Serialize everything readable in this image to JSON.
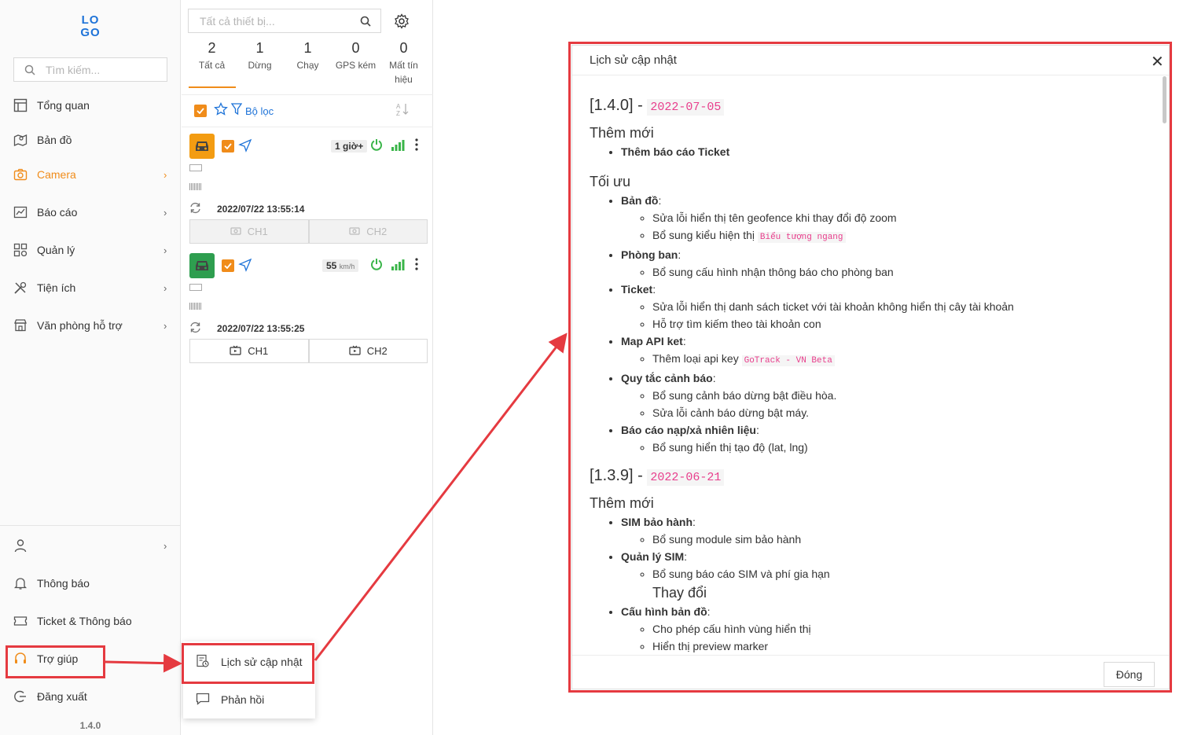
{
  "sidebar": {
    "logo_text": "LOGO",
    "search_placeholder": "Tìm kiếm...",
    "items": [
      {
        "label": "Tổng quan",
        "icon": "dashboard-icon"
      },
      {
        "label": "Bản đồ",
        "icon": "map-icon"
      },
      {
        "label": "Camera",
        "icon": "camera-icon",
        "active": true
      },
      {
        "label": "Báo cáo",
        "icon": "report-icon"
      },
      {
        "label": "Quản lý",
        "icon": "grid-icon"
      },
      {
        "label": "Tiện ích",
        "icon": "tools-icon"
      },
      {
        "label": "Văn phòng hỗ trợ",
        "icon": "store-icon"
      }
    ],
    "bottom_items": [
      {
        "label": "",
        "icon": "user-icon"
      },
      {
        "label": "Thông báo",
        "icon": "bell-icon"
      },
      {
        "label": "Ticket & Thông báo",
        "icon": "ticket-icon"
      },
      {
        "label": "Trợ giúp",
        "icon": "headset-icon"
      },
      {
        "label": "Đăng xuất",
        "icon": "logout-icon"
      }
    ],
    "version": "1.4.0"
  },
  "device_panel": {
    "search_placeholder": "Tất cả thiết bị...",
    "stats": [
      {
        "count": "2",
        "label": "Tất cả"
      },
      {
        "count": "1",
        "label": "Dừng"
      },
      {
        "count": "1",
        "label": "Chạy"
      },
      {
        "count": "0",
        "label": "GPS kém"
      },
      {
        "count": "0",
        "label": "Mất tín hiệu"
      }
    ],
    "filter_label": "Bộ lọc",
    "devices": [
      {
        "badge": "1 giờ+",
        "unit": "",
        "time": "2022/07/22 13:55:14",
        "ch1": "CH1",
        "ch2": "CH2",
        "status_color": "#f39c12"
      },
      {
        "badge": "55",
        "unit": "km/h",
        "time": "2022/07/22 13:55:25",
        "ch1": "CH1",
        "ch2": "CH2",
        "status_color": "#2e9e4f"
      }
    ]
  },
  "popup_menu": {
    "items": [
      {
        "label": "Lịch sử cập nhật",
        "icon": "history-icon"
      },
      {
        "label": "Phản hồi",
        "icon": "feedback-icon"
      }
    ]
  },
  "dialog": {
    "title": "Lịch sử cập nhật",
    "close_label": "Đóng",
    "releases": [
      {
        "version": "[1.4.0]",
        "sep": " - ",
        "date": "2022-07-05",
        "sections": {
          "added_title": "Thêm mới",
          "added_item": "Thêm báo cáo Ticket",
          "optimized_title": "Tối ưu",
          "map": {
            "title": "Bản đồ",
            "items": [
              "Sửa lỗi hiển thị tên geofence khi thay đổi độ zoom",
              "Bổ sung kiểu hiện thị"
            ],
            "code": "Biểu tượng ngang"
          },
          "dept": {
            "title": "Phòng ban",
            "items": [
              "Bổ sung cấu hình nhận thông báo cho phòng ban"
            ]
          },
          "ticket": {
            "title": "Ticket",
            "items": [
              "Sửa lỗi hiển thị danh sách ticket với tài khoản không hiển thị cây tài khoản",
              "Hỗ trợ tìm kiếm theo tài khoản con"
            ]
          },
          "mapapi": {
            "title": "Map API ket",
            "items": [
              "Thêm loại api key"
            ],
            "code": "GoTrack - VN Beta"
          },
          "alert": {
            "title": "Quy tắc cảnh báo",
            "items": [
              "Bổ sung cảnh báo dừng bật điều hòa.",
              "Sửa lỗi cảnh báo dừng bật máy."
            ]
          },
          "fuel": {
            "title": "Báo cáo nạp/xả nhiên liệu",
            "items": [
              "Bổ sung hiển thị tạo độ (lat, lng)"
            ]
          }
        }
      },
      {
        "version": "[1.3.9]",
        "sep": " - ",
        "date": "2022-06-21",
        "sections": {
          "added_title": "Thêm mới",
          "sim": {
            "title": "SIM bảo hành",
            "items": [
              "Bổ sung module sim bảo hành"
            ]
          },
          "simmgr": {
            "title": "Quản lý SIM",
            "items": [
              "Bổ sung báo cáo SIM và phí gia hạn"
            ]
          },
          "changed_title": "Thay đổi",
          "mapcfg": {
            "title": "Cấu hình bản đồ",
            "items": [
              "Cho phép cấu hình vùng hiển thị",
              "Hiển thị preview marker"
            ]
          }
        }
      }
    ]
  },
  "colors": {
    "accent": "#f08c1a",
    "link": "#1e73d8",
    "annotation": "#e53a40",
    "code": "#e83e8c"
  }
}
